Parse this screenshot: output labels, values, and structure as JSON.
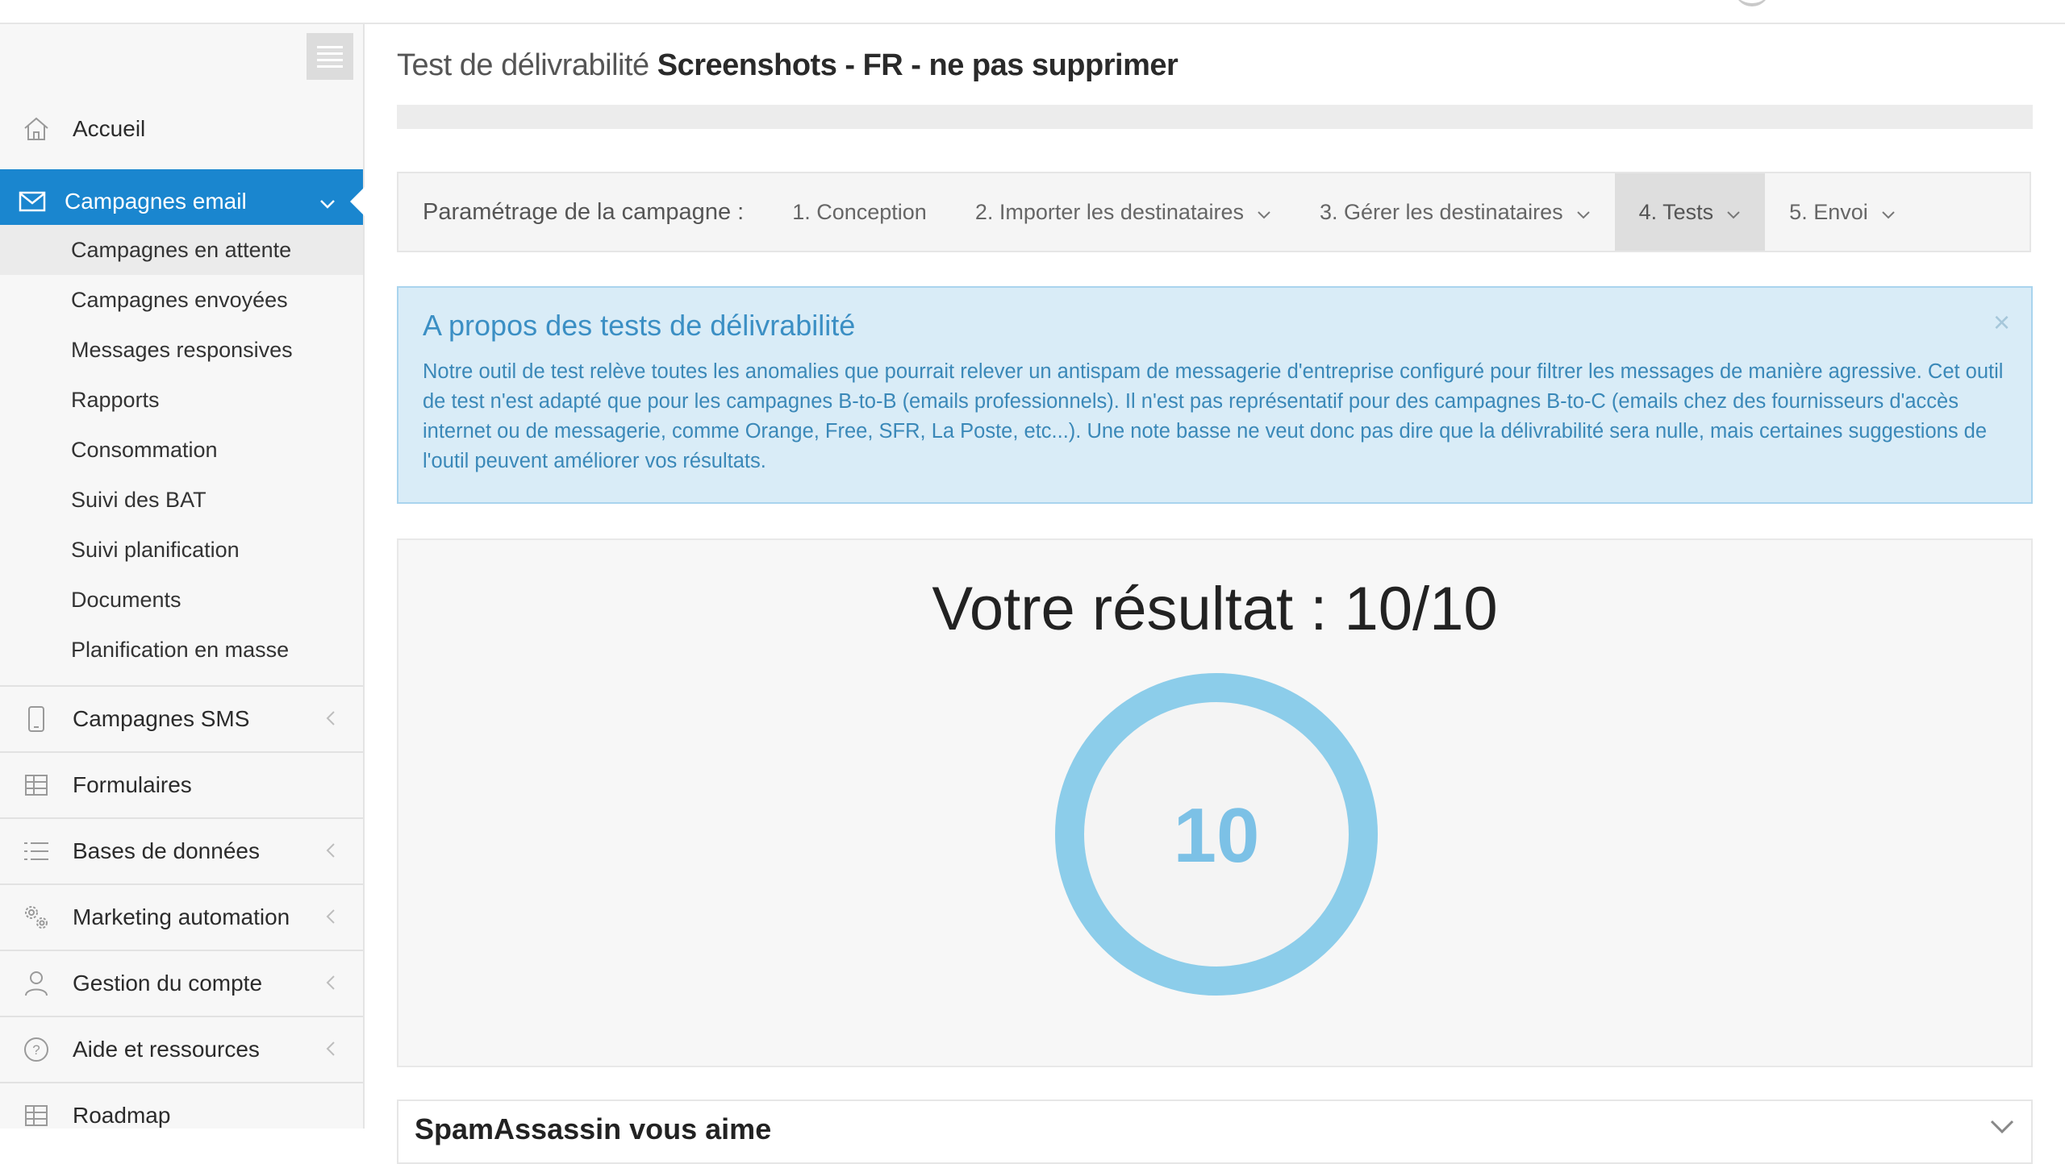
{
  "sidebar": {
    "top_item": {
      "label": "Accueil",
      "icon": "home-icon"
    },
    "active_section": {
      "label": "Campagnes email",
      "icon": "envelope-icon"
    },
    "sub_items": [
      {
        "label": "Campagnes en attente"
      },
      {
        "label": "Campagnes envoyées"
      },
      {
        "label": "Messages responsives"
      },
      {
        "label": "Rapports"
      },
      {
        "label": "Consommation"
      },
      {
        "label": "Suivi des BAT"
      },
      {
        "label": "Suivi planification"
      },
      {
        "label": "Documents"
      },
      {
        "label": "Planification en masse"
      }
    ],
    "sections": [
      {
        "label": "Campagnes SMS",
        "icon": "mobile-icon"
      },
      {
        "label": "Formulaires",
        "icon": "table-icon"
      },
      {
        "label": "Bases de données",
        "icon": "list-icon"
      },
      {
        "label": "Marketing automation",
        "icon": "gears-icon"
      },
      {
        "label": "Gestion du compte",
        "icon": "user-icon"
      },
      {
        "label": "Aide et ressources",
        "icon": "help-icon"
      },
      {
        "label": "Roadmap",
        "icon": "table-icon"
      }
    ]
  },
  "header": {
    "title_prefix": "Test de délivrabilité",
    "campaign_name": "Screenshots - FR - ne pas supprimer"
  },
  "steps": {
    "label": "Paramétrage de la campagne :",
    "items": [
      {
        "label": "1. Conception"
      },
      {
        "label": "2. Importer les destinataires"
      },
      {
        "label": "3. Gérer les destinataires"
      },
      {
        "label": "4. Tests"
      },
      {
        "label": "5. Envoi"
      }
    ],
    "current": "4. Tests"
  },
  "info_alert": {
    "title": "A propos des tests de délivrabilité",
    "body": "Notre outil de test relève toutes les anomalies que pourrait relever un antispam de messagerie d'entreprise configuré pour filtrer les messages de manière agressive. Cet outil de test n'est adapté que pour les campagnes B-to-B (emails professionnels). Il n'est pas représentatif pour des campagnes B-to-C (emails chez des fournisseurs d'accès internet ou de messagerie, comme Orange, Free, SFR, La Poste, etc...). Une note basse ne veut donc pas dire que la délivrabilité sera nulle, mais certaines suggestions de l'outil peuvent améliorer vos résultats.",
    "close_symbol": "×"
  },
  "result": {
    "title": "Votre résultat : 10/10",
    "score": 10,
    "max": 10,
    "score_text": "10",
    "ring_color": "#8ccdea",
    "text_color": "#7cc1e6"
  },
  "spamassassin": {
    "title": "SpamAssassin vous aime"
  },
  "colors": {
    "accent": "#1a86cf",
    "alert_bg": "#d9ecf7",
    "alert_text": "#3a88b8"
  }
}
